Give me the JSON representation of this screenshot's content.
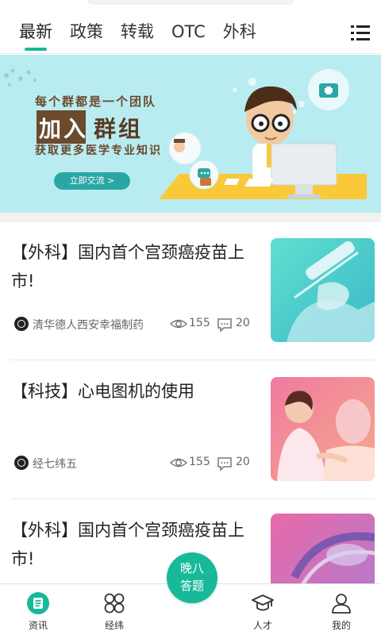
{
  "tabs": [
    {
      "label": "最新",
      "active": true
    },
    {
      "label": "政策",
      "active": false
    },
    {
      "label": "转载",
      "active": false
    },
    {
      "label": "OTC",
      "active": false
    },
    {
      "label": "外科",
      "active": false
    }
  ],
  "menu_icon": "list-menu-icon",
  "accent_color": "#17b99a",
  "banner": {
    "slogan": "每个群都是一个团队",
    "join_box": "加入",
    "join_rest": "群组",
    "subtitle": "获取更多医学专业知识",
    "cta": "立即交流 >"
  },
  "news": [
    {
      "title": "【外科】国内首个宫颈癌疫苗上市!",
      "source": "清华德人西安幸福制药",
      "views": "155",
      "comments": "20",
      "thumb": "syringe-vaccine-image"
    },
    {
      "title": "【科技】心电图机的使用",
      "source": "经七纬五",
      "views": "155",
      "comments": "20",
      "thumb": "nurse-patient-image"
    },
    {
      "title": "【外科】国内首个宫颈癌疫苗上市!",
      "source": "",
      "views": "",
      "comments": "",
      "thumb": "medical-equipment-image"
    }
  ],
  "bottom_nav": [
    {
      "label": "资讯",
      "icon": "news-icon",
      "active": true
    },
    {
      "label": "经纬",
      "icon": "grid-icon",
      "active": false
    },
    {
      "label": "人才",
      "icon": "graduation-cap-icon",
      "active": false
    },
    {
      "label": "我的",
      "icon": "user-icon",
      "active": false
    }
  ],
  "fab": {
    "line1": "晚八",
    "line2": "答题"
  }
}
